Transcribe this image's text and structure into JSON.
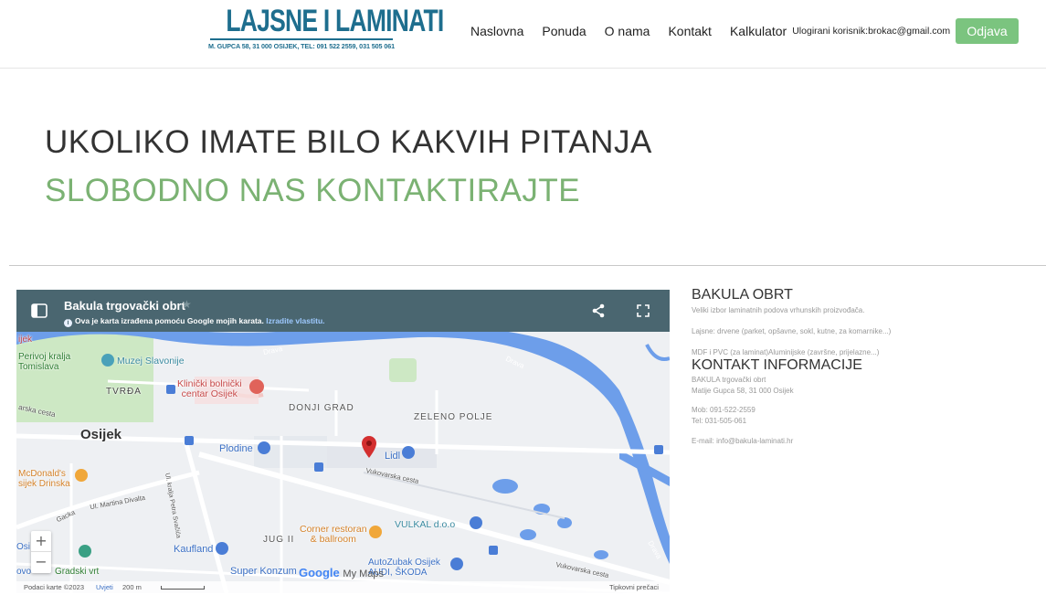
{
  "header": {
    "logo_title": "LAJSNE I LAMINATI",
    "logo_subtitle": "M. GUPCA 58, 31 000 OSIJEK, TEL: 091 522 2559, 031 505 061",
    "nav": [
      "Naslovna",
      "Ponuda",
      "O nama",
      "Kontakt",
      "Kalkulator"
    ],
    "user_label": "Ulogirani korisnik:brokac@gmail.com",
    "logout_label": "Odjava"
  },
  "hero": {
    "line1": "UKOLIKO IMATE BILO KAKVIH PITANJA",
    "line2": "SLOBODNO NAS KONTAKTIRAJTE"
  },
  "map": {
    "title": "Bakula trgovački obrt",
    "info_text": "Ova je karta izrađena pomoću Google mojih karata.",
    "info_link": "Izradite vlastitu.",
    "labels": {
      "perivoj": "Perivoj kralja\nTomislava",
      "muzej": "Muzej Slavonije",
      "tvrda": "TVRĐA",
      "klinicki": "Klinički bolnički\ncentar Osijek",
      "donji_grad": "DONJI GRAD",
      "zeleno_polje": "ZELENO POLJE",
      "osijek": "Osijek",
      "plodine": "Plodine",
      "lidl": "Lidl",
      "mcdonalds": "McDonald's\nsijek Drinska",
      "martina": "Ul. Martina Divalta",
      "kralja_petra": "Ul. kralja Petra Svačića",
      "vukovarska": "Vukovarska cesta",
      "vukovarska2": "Vukovarska cesta",
      "drava1": "Drava",
      "drava2": "Drava",
      "drava3": "Drava",
      "vulkal": "VULKAL d.o.o",
      "jug": "JUG II",
      "corner": "Corner restoran\n& ballroom",
      "kaufland": "Kaufland",
      "autozubak": "AutoZubak Osijek\nAUDI, ŠKODA",
      "super_konzum": "Super Konzum",
      "gradski": "Gradski vrt",
      "ijek": "ijek",
      "osi": "Osi",
      "ovo": "ovo",
      "gacka": "Gacka",
      "arska": "arska cesta"
    },
    "google_logo": "Google",
    "my_maps": "My Maps",
    "footer": {
      "data": "Podaci karte ©2023",
      "terms": "Uvjeti",
      "scale": "200 m",
      "shortcuts": "Tipkovni prečaci"
    },
    "zoom_in": "+",
    "zoom_out": "−",
    "icons": [
      "menu-icon",
      "star-icon",
      "info-icon",
      "share-icon",
      "fullscreen-icon",
      "map-pin-icon"
    ]
  },
  "contact": {
    "heading1": "BAKULA OBRT",
    "intro": "Veliki izbor laminatnih podova vrhunskih proizvođača.",
    "lajsne": "Lajsne: drvene (parket, opšavne, sokl, kutne, za komarnike...)",
    "mdf": "MDF i PVC (za laminat)Aluminijske (završne, prijelazne...)",
    "heading2": "KONTAKT INFORMACIJE",
    "company": "BAKULA trgovački obrt",
    "address": "Matije Gupca 58, 31 000 Osijek",
    "mob": "Mob: 091-522-2559",
    "tel": "Tel: 031-505-061",
    "email": "E-mail: info@bakula-laminati.hr"
  },
  "colors": {
    "brand_blue": "#1e6e8e",
    "accent_green": "#7bb273",
    "button_green": "#7bc47f",
    "map_header": "#4a6670",
    "river": "#6d9eea",
    "pin_red": "#d32f2f"
  }
}
